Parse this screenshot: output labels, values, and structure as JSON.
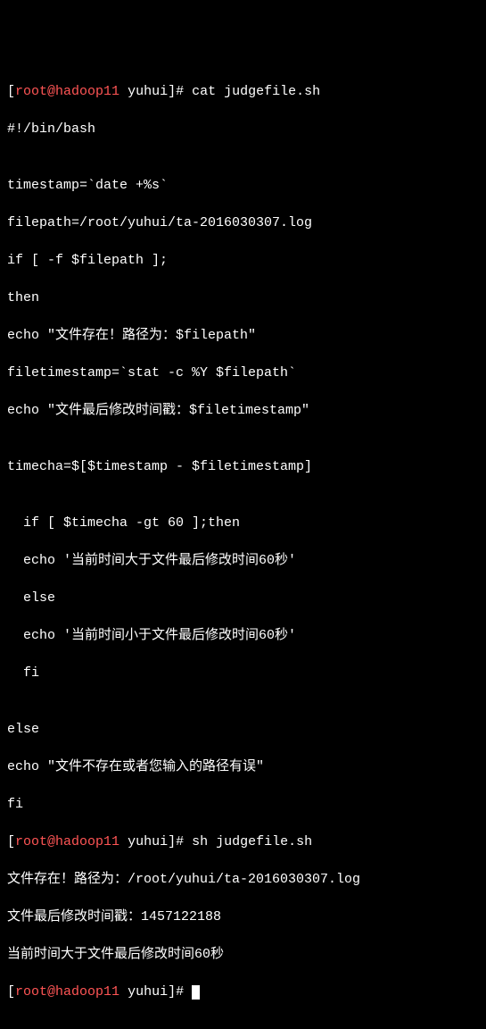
{
  "prompt": {
    "open": "[",
    "user": "root",
    "at": "@",
    "host": "hadoop11",
    "space": " ",
    "path": "yuhui",
    "close": "]",
    "hash": "#"
  },
  "commands": {
    "cat": "cat judgefile.sh",
    "sh": "sh judgefile.sh",
    "empty": ""
  },
  "script": {
    "line1": "#!/bin/bash",
    "line2": "",
    "line3": "timestamp=`date +%s`",
    "line4": "filepath=/root/yuhui/ta-2016030307.log",
    "line5": "if [ -f $filepath ];",
    "line6": "then",
    "line7": "echo \"文件存在！路径为：$filepath\"",
    "line8": "filetimestamp=`stat -c %Y $filepath`",
    "line9": "echo \"文件最后修改时间戳：$filetimestamp\"",
    "line10": "",
    "line11": "timecha=$[$timestamp - $filetimestamp]",
    "line12": "",
    "line13": "  if [ $timecha -gt 60 ];then",
    "line14": "  echo '当前时间大于文件最后修改时间60秒'",
    "line15": "  else",
    "line16": "  echo '当前时间小于文件最后修改时间60秒'",
    "line17": "  fi",
    "line18": "",
    "line19": "else",
    "line20": "echo \"文件不存在或者您输入的路径有误\"",
    "line21": "fi"
  },
  "output": {
    "line1": "文件存在！路径为：/root/yuhui/ta-2016030307.log",
    "line2": "文件最后修改时间戳：1457122188",
    "line3": "当前时间大于文件最后修改时间60秒"
  }
}
